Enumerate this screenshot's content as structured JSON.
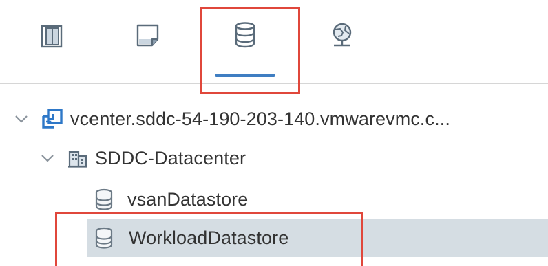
{
  "tabs": [
    {
      "id": "hosts-clusters",
      "icon": "hosts-clusters-icon"
    },
    {
      "id": "vms-templates",
      "icon": "vms-templates-icon"
    },
    {
      "id": "storage",
      "icon": "storage-icon",
      "active": true
    },
    {
      "id": "networking",
      "icon": "networking-icon"
    }
  ],
  "tree": {
    "vcenter": {
      "label": "vcenter.sddc-54-190-203-140.vmwarevmc.c...",
      "icon": "vcenter-icon",
      "expanded": true
    },
    "datacenter": {
      "label": "SDDC-Datacenter",
      "icon": "datacenter-icon",
      "expanded": true
    },
    "datastores": [
      {
        "label": "vsanDatastore",
        "icon": "datastore-icon",
        "selected": false
      },
      {
        "label": "WorkloadDatastore",
        "icon": "datastore-icon",
        "selected": true
      }
    ]
  },
  "colors": {
    "active_tab_underline": "#3f7ec2",
    "highlight_box": "#e0473b",
    "selected_row_bg": "#d5dde3",
    "vcenter_icon": "#2e78c8"
  }
}
